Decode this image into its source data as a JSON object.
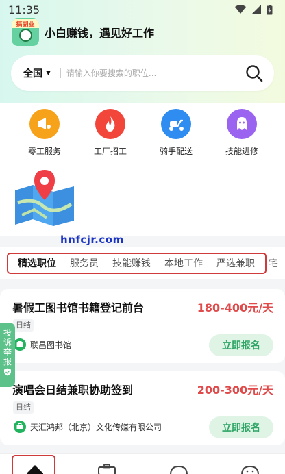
{
  "status": {
    "time": "11:35"
  },
  "brand": {
    "logo_text": "搞副业",
    "slogan": "小白赚钱，遇见好工作"
  },
  "search": {
    "city": "全国",
    "placeholder": "请输入你要搜索的职位..."
  },
  "categories": [
    {
      "label": "零工服务",
      "icon": "megaphone-icon",
      "color": "#f7a21b"
    },
    {
      "label": "工厂招工",
      "icon": "flame-icon",
      "color": "#f2463b"
    },
    {
      "label": "骑手配送",
      "icon": "scooter-icon",
      "color": "#2f8cf0"
    },
    {
      "label": "技能进修",
      "icon": "ghost-icon",
      "color": "#9a63f0"
    }
  ],
  "watermark": "hnfcjr.com",
  "tabs": [
    "精选职位",
    "服务员",
    "技能赚钱",
    "本地工作",
    "严选兼职",
    "宅"
  ],
  "jobs": [
    {
      "title": "暑假工图书馆书籍登记前台",
      "salary": "180-400元/天",
      "tag": "日结",
      "company": "联昌图书馆",
      "apply": "立即报名"
    },
    {
      "title": "演唱会日结兼职协助签到",
      "salary": "200-300元/天",
      "tag": "日结",
      "company": "天汇鸿邦（北京）文化传媒有限公司",
      "apply": "立即报名"
    }
  ],
  "report": {
    "label": "投诉举报"
  },
  "colors": {
    "accent_green": "#2ea565",
    "salary_red": "#e04a4a",
    "highlight_red": "#cf3b3b"
  }
}
